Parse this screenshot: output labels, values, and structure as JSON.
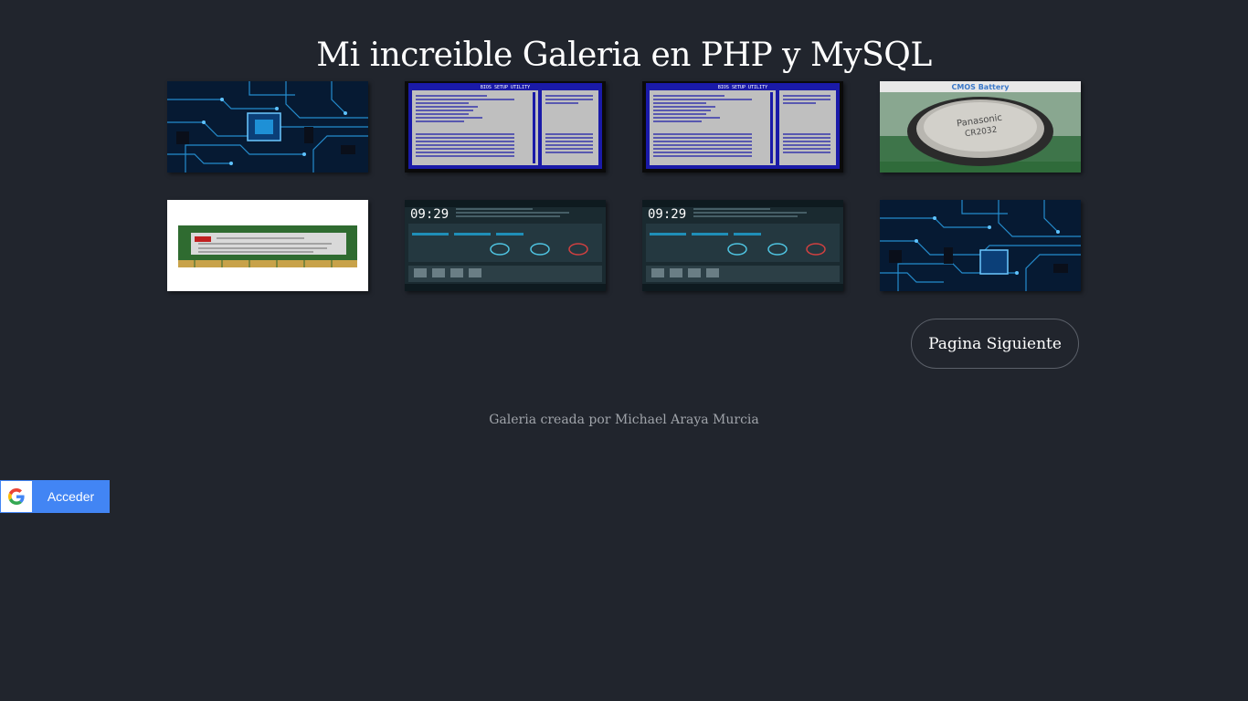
{
  "header": {
    "title": "Mi increible Galeria en PHP y MySQL"
  },
  "gallery": {
    "images": [
      {
        "icon": "circuit-board-image"
      },
      {
        "icon": "bios-setup-image",
        "title": "BIOS SETUP UTILITY"
      },
      {
        "icon": "bios-setup-image",
        "title": "BIOS SETUP UTILITY"
      },
      {
        "icon": "cmos-battery-image",
        "caption": "CMOS Battery",
        "battery_text": "Panasonic CR2032 3V"
      },
      {
        "icon": "ram-module-image",
        "label_text": "hynix"
      },
      {
        "icon": "uefi-bios-image",
        "clock": "09:29"
      },
      {
        "icon": "uefi-bios-image",
        "clock": "09:29"
      },
      {
        "icon": "circuit-board-image"
      }
    ]
  },
  "navigation": {
    "next_page_label": "Pagina Siguiente"
  },
  "footer": {
    "credit": "Galeria creada por Michael Araya Murcia"
  },
  "google_signin": {
    "label": "Acceder"
  },
  "colors": {
    "background": "#21252d",
    "google_blue": "#4285f4",
    "circuit_blue": "#1e90d6",
    "bios_blue": "#1a1aa8"
  }
}
